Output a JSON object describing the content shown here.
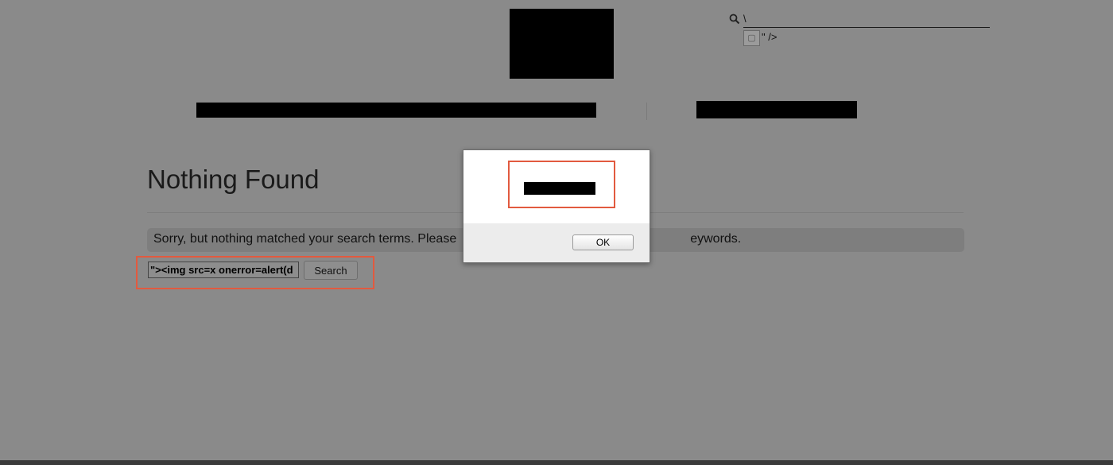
{
  "header": {
    "search_prefix": "\\",
    "injected_tail": "\" />"
  },
  "main": {
    "title": "Nothing Found",
    "message_visible_left": "Sorry, but nothing matched your search terms. Please",
    "message_visible_right": "eywords."
  },
  "search_form": {
    "input_value": "\"><img src=x onerror=alert(d",
    "button_label": "Search"
  },
  "alert_dialog": {
    "ok_label": "OK"
  },
  "colors": {
    "overlay_gray": "#8a8a8a",
    "highlight_orange": "#e25a3f",
    "redaction": "#000000"
  },
  "icons": [
    "search-icon",
    "broken-image-icon"
  ]
}
